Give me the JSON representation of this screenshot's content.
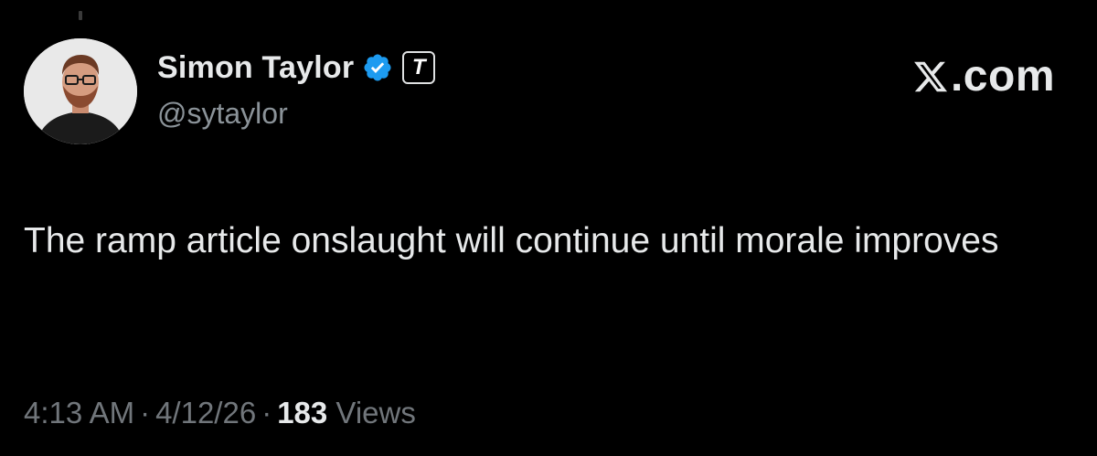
{
  "author": {
    "display_name": "Simon Taylor",
    "handle": "@sytaylor",
    "verified_icon": "verified-badge-icon",
    "affiliate_badge_letter": "T",
    "avatar_icon": "profile-photo"
  },
  "brand": {
    "text": ".com",
    "logo_icon": "x-logo-icon"
  },
  "tweet": {
    "text": "The ramp article onslaught will continue until morale improves"
  },
  "meta": {
    "time": "4:13 AM",
    "separator": "·",
    "date": "4/12/26",
    "views_count": "183",
    "views_label": "Views"
  },
  "colors": {
    "background": "#000000",
    "primary_text": "#e7e9ea",
    "secondary_text": "#71767b",
    "verified_blue": "#1d9bf0"
  }
}
